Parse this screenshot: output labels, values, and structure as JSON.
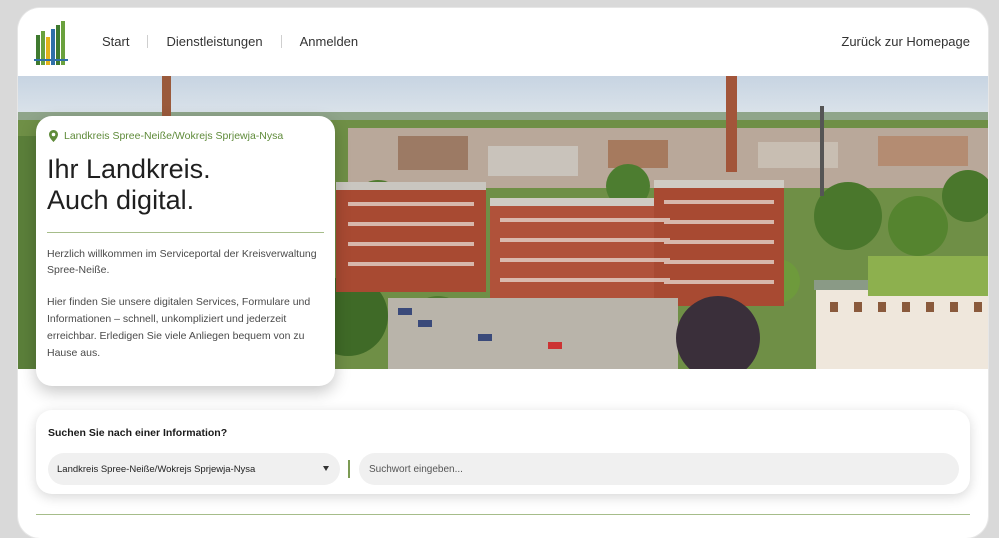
{
  "header": {
    "logo_icon": "kreis-logo-bars",
    "nav": [
      {
        "label": "Start"
      },
      {
        "label": "Dienstleistungen"
      },
      {
        "label": "Anmelden"
      }
    ],
    "back_link": "Zurück zur Homepage"
  },
  "hero": {
    "image": "aerial-photo-kreisverwaltung-building",
    "card": {
      "org_icon": "location-pin-icon",
      "org": "Landkreis Spree-Neiße/Wokrejs Sprjewja-Nysa",
      "title_line1": "Ihr Landkreis.",
      "title_line2": "Auch digital.",
      "paragraph1": "Herzlich willkommen im Serviceportal der Kreisverwaltung Spree-Neiße.",
      "paragraph2": "Hier finden Sie unsere digitalen Services, Formulare und Informationen – schnell, unkompliziert und jederzeit erreichbar. Erledigen Sie viele Anliegen bequem von zu Hause aus."
    }
  },
  "search": {
    "title": "Suchen Sie nach einer Information?",
    "region_selected": "Landkreis Spree-Neiße/Wokrejs Sprjewja-Nysa",
    "placeholder": "Suchwort eingeben..."
  },
  "colors": {
    "accent_green": "#5f8b3a",
    "rule_green": "#a6bd8a",
    "brick": "#a84a32"
  }
}
